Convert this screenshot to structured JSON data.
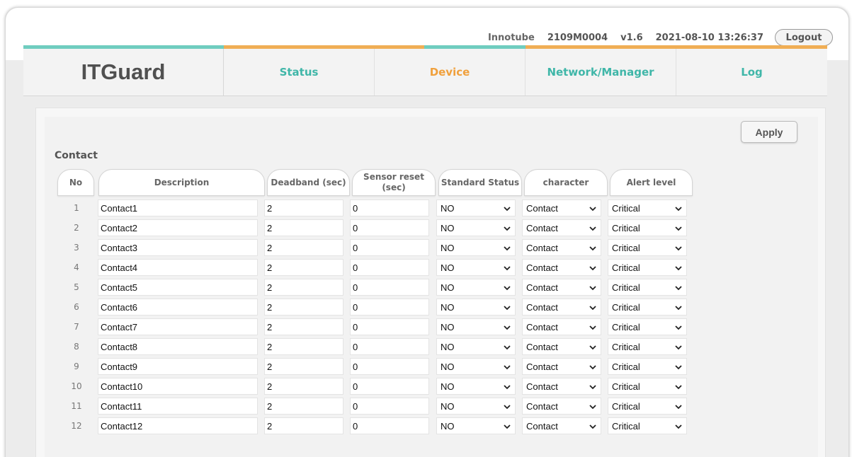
{
  "header": {
    "product": "Innotube",
    "serial": "2109M0004",
    "version": "v1.6",
    "datetime": "2021-08-10 13:26:37",
    "logout_label": "Logout"
  },
  "nav": {
    "brand": "ITGuard",
    "tabs": [
      {
        "label": "Status",
        "color": "#3fb6a8"
      },
      {
        "label": "Device",
        "color": "#f0a03c"
      },
      {
        "label": "Network/Manager",
        "color": "#3fb6a8"
      },
      {
        "label": "Log",
        "color": "#3fb6a8"
      }
    ]
  },
  "colors": {
    "teal": "#6fcdbf",
    "orange": "#f0ae55"
  },
  "page": {
    "apply_label": "Apply",
    "section_title": "Contact",
    "columns": {
      "no": "No",
      "description": "Description",
      "deadband": "Deadband (sec)",
      "sensor_reset": "Sensor reset (sec)",
      "standard_status": "Standard Status",
      "character": "character",
      "alert_level": "Alert level"
    },
    "rows": [
      {
        "no": "1",
        "description": "Contact1",
        "deadband": "2",
        "sensor_reset": "0",
        "standard_status": "NO",
        "character": "Contact",
        "alert_level": "Critical"
      },
      {
        "no": "2",
        "description": "Contact2",
        "deadband": "2",
        "sensor_reset": "0",
        "standard_status": "NO",
        "character": "Contact",
        "alert_level": "Critical"
      },
      {
        "no": "3",
        "description": "Contact3",
        "deadband": "2",
        "sensor_reset": "0",
        "standard_status": "NO",
        "character": "Contact",
        "alert_level": "Critical"
      },
      {
        "no": "4",
        "description": "Contact4",
        "deadband": "2",
        "sensor_reset": "0",
        "standard_status": "NO",
        "character": "Contact",
        "alert_level": "Critical"
      },
      {
        "no": "5",
        "description": "Contact5",
        "deadband": "2",
        "sensor_reset": "0",
        "standard_status": "NO",
        "character": "Contact",
        "alert_level": "Critical"
      },
      {
        "no": "6",
        "description": "Contact6",
        "deadband": "2",
        "sensor_reset": "0",
        "standard_status": "NO",
        "character": "Contact",
        "alert_level": "Critical"
      },
      {
        "no": "7",
        "description": "Contact7",
        "deadband": "2",
        "sensor_reset": "0",
        "standard_status": "NO",
        "character": "Contact",
        "alert_level": "Critical"
      },
      {
        "no": "8",
        "description": "Contact8",
        "deadband": "2",
        "sensor_reset": "0",
        "standard_status": "NO",
        "character": "Contact",
        "alert_level": "Critical"
      },
      {
        "no": "9",
        "description": "Contact9",
        "deadband": "2",
        "sensor_reset": "0",
        "standard_status": "NO",
        "character": "Contact",
        "alert_level": "Critical"
      },
      {
        "no": "10",
        "description": "Contact10",
        "deadband": "2",
        "sensor_reset": "0",
        "standard_status": "NO",
        "character": "Contact",
        "alert_level": "Critical"
      },
      {
        "no": "11",
        "description": "Contact11",
        "deadband": "2",
        "sensor_reset": "0",
        "standard_status": "NO",
        "character": "Contact",
        "alert_level": "Critical"
      },
      {
        "no": "12",
        "description": "Contact12",
        "deadband": "2",
        "sensor_reset": "0",
        "standard_status": "NO",
        "character": "Contact",
        "alert_level": "Critical"
      }
    ]
  }
}
